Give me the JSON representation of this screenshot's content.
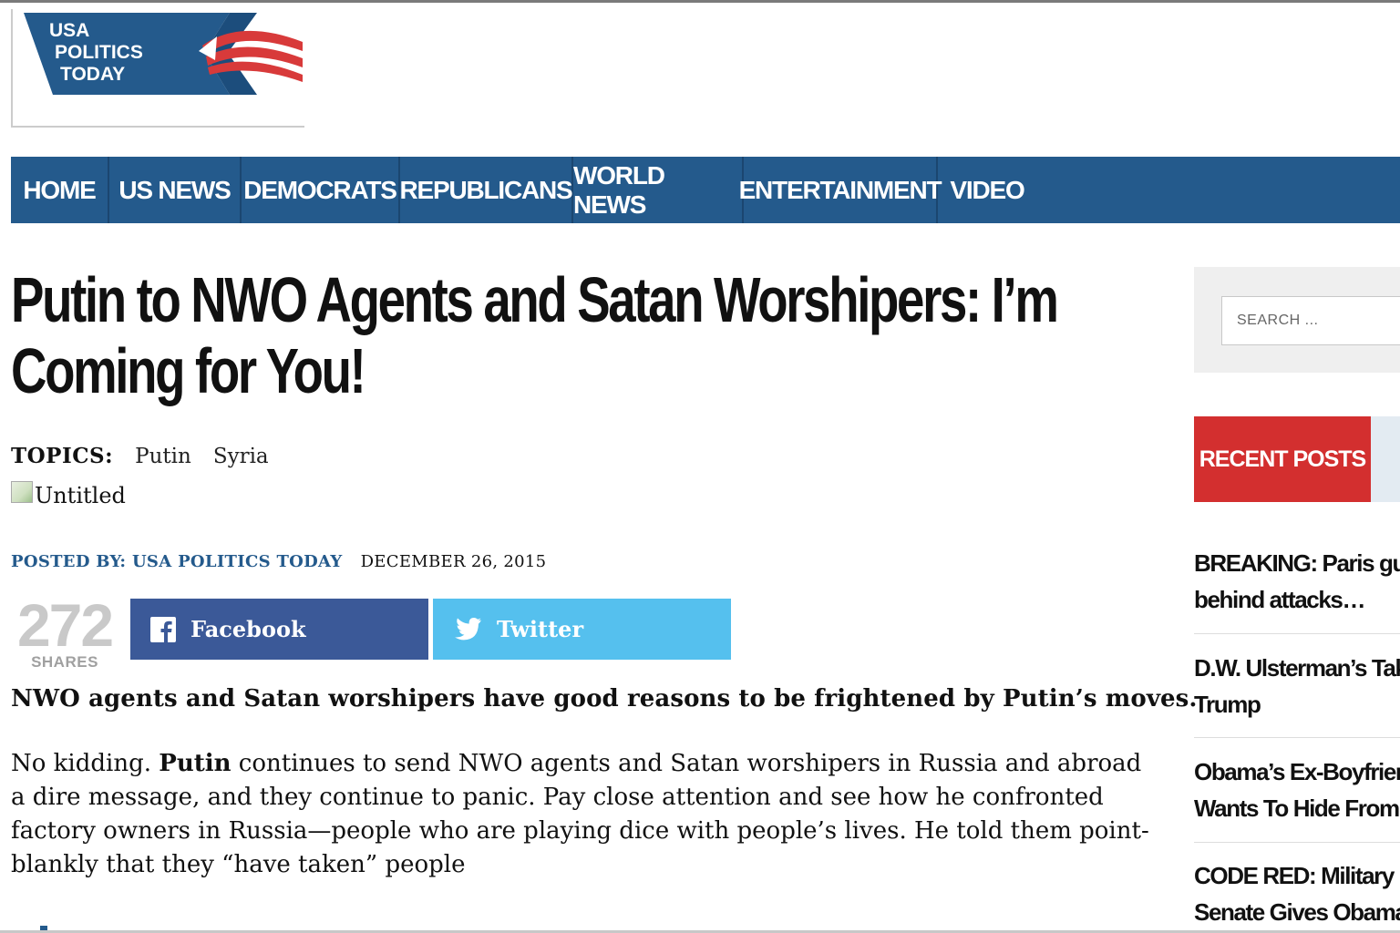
{
  "logo": {
    "line1": "USA",
    "line2": "POLITICS",
    "line3": "TODAY",
    "color": "#245a8c"
  },
  "nav": {
    "items": [
      "HOME",
      "US NEWS",
      "DEMOCRATS",
      "REPUBLICANS",
      "WORLD NEWS",
      "ENTERTAINMENT",
      "VIDEO"
    ]
  },
  "article": {
    "title": "Putin to NWO Agents and Satan Worshipers: I’m Coming for You!",
    "topics_label": "TOPICS:",
    "topics": [
      "Putin",
      "Syria"
    ],
    "image_alt": "Untitled",
    "posted_by": "POSTED BY: USA POLITICS TODAY",
    "date": "DECEMBER 26, 2015",
    "shares_count": "272",
    "shares_label": "SHARES",
    "facebook_label": "Facebook",
    "twitter_label": "Twitter",
    "lead": "NWO agents and Satan worshipers have good reasons to be frightened by Putin’s moves.",
    "body_intro": "No kidding. ",
    "body_bold": "Putin",
    "body_rest": " continues to send NWO agents and Satan worshipers in Russia and abroad a dire message, and they continue to panic. Pay close attention and see how he confronted factory owners in Russia—people who are playing dice with people’s lives. He told them point-blankly that they “have taken” people"
  },
  "sidebar": {
    "search_placeholder": "SEARCH ...",
    "recent_posts_label": "RECENT POSTS",
    "posts": [
      {
        "line1": "BREAKING: Paris gunm",
        "line2": "behind attacks…"
      },
      {
        "line1": "D.W. Ulsterman’s Take",
        "line2": "Trump"
      },
      {
        "line1": "Obama’s Ex-Boyfriend",
        "line2": "Wants To Hide From An"
      },
      {
        "line1": "CODE RED: Military Mar",
        "line2": "Senate Gives Obama U"
      }
    ]
  },
  "colors": {
    "nav_bg": "#245a8c",
    "facebook": "#3b5998",
    "twitter": "#55c0ee",
    "recent_posts": "#d32f2f"
  }
}
